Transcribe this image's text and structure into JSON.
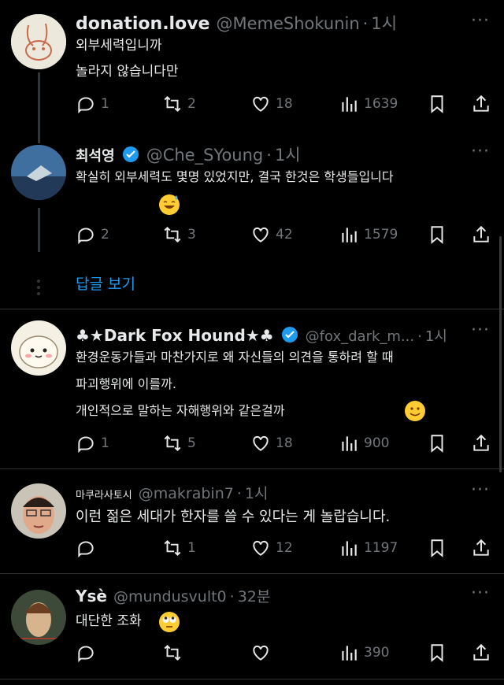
{
  "tweets": [
    {
      "name": "donation.love",
      "handle": "@MemeShokunin",
      "time": "1시",
      "lines": [
        "외부세력입니까",
        "놀라지 않습니다만"
      ],
      "replies": "1",
      "retweets": "2",
      "likes": "18",
      "views": "1639"
    },
    {
      "name": "최석영",
      "handle": "@Che_SYoung",
      "time": "1시",
      "lines": [
        "확실히 외부세력도 몇명 있었지만, 결국 한것은 학생들입니다"
      ],
      "replies": "2",
      "retweets": "3",
      "likes": "42",
      "views": "1579"
    },
    {
      "name": "♣★Dark Fox Hound★♣",
      "handle": "@fox_dark_m...",
      "time": "1시",
      "lines": [
        "환경운동가들과 마찬가지로 왜 자신들의 의견을 통하려 할 때",
        "파괴행위에 이를까.",
        "개인적으로 말하는 자해행위와 같은걸까"
      ],
      "replies": "1",
      "retweets": "5",
      "likes": "18",
      "views": "900"
    },
    {
      "name": "마쿠라사토시",
      "handle": "@makrabin7",
      "time": "1시",
      "lines": [
        "이런 젊은 세대가 한자를 쓸 수 있다는 게 놀랍습니다."
      ],
      "replies": "",
      "retweets": "1",
      "likes": "12",
      "views": "1197"
    },
    {
      "name": "Ysè",
      "handle": "@mundusvult0",
      "time": "32분",
      "lines": [
        "대단한 조화"
      ],
      "replies": "",
      "retweets": "",
      "likes": "",
      "views": "390"
    }
  ],
  "show_replies": "답글 보기",
  "colors": {
    "background": "#000000",
    "text": "#e7e9ea",
    "muted": "#71767b",
    "accent": "#1d9bf0"
  },
  "icons": [
    "reply-icon",
    "retweet-icon",
    "like-icon",
    "views-icon",
    "bookmark-icon",
    "share-icon",
    "verified-icon",
    "more-icon"
  ]
}
